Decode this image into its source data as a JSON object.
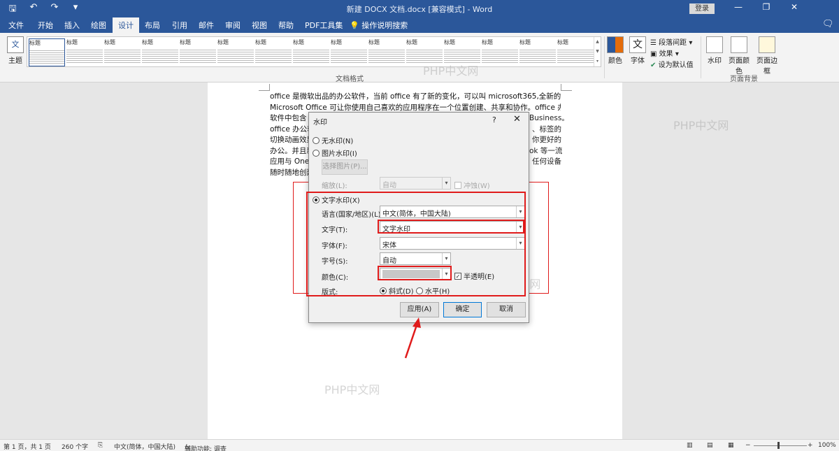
{
  "titlebar": {
    "title": "新建 DOCX 文档.docx [兼容模式] - Word",
    "login": "登录",
    "qat": [
      "save-icon",
      "undo-icon",
      "redo-icon",
      "customize-icon"
    ],
    "qat_glyphs": [
      "🖫",
      "↶",
      "↷",
      "▾"
    ],
    "controls": [
      "—",
      "❐",
      "✕"
    ]
  },
  "tabs": [
    {
      "label": "文件"
    },
    {
      "label": "开始"
    },
    {
      "label": "插入"
    },
    {
      "label": "绘图"
    },
    {
      "label": "设计"
    },
    {
      "label": "布局"
    },
    {
      "label": "引用"
    },
    {
      "label": "邮件"
    },
    {
      "label": "审阅"
    },
    {
      "label": "视图"
    },
    {
      "label": "帮助"
    },
    {
      "label": "PDF工具集"
    }
  ],
  "tell_me": "操作说明搜索",
  "ribbon": {
    "theme": "主题",
    "theme_icon_text": "文",
    "styles_group": "文档格式",
    "style_thumbs": [
      "标题",
      "标题",
      "标题",
      "标题",
      "标题",
      "标题",
      "标题",
      "标题",
      "标题",
      "标题",
      "标题",
      "标题",
      "标题",
      "标题",
      "标题",
      "标题"
    ],
    "colors": "颜色",
    "fonts": "字体",
    "fonts_icon_text": "文",
    "para_spacing": "段落间距",
    "effects": "效果",
    "set_default": "设为默认值",
    "watermark": "水印",
    "page_color": "页面颜色",
    "page_border": "页面边框",
    "page_bg_group": "页面背景"
  },
  "document": {
    "lines": [
      "office 是微软出品的办公软件，当前 office 有了新的变化，可以叫 microsoft365,全新的",
      "Microsoft Office 可让你使用自己喜欢的应用程序在一个位置创建、共享和协作。office 办公",
      "软件中包含",
      "office 办公软",
      "切换动画效果",
      "办公。并且新",
      "应用与 OneD",
      "随时随地创建"
    ],
    "right_fragments": [
      "Business。",
      "、标签的",
      "你更好的",
      "ok 等一流",
      "任何设备"
    ]
  },
  "dialog": {
    "title": "水印",
    "help": "?",
    "close": "✕",
    "no_watermark": "无水印(N)",
    "picture_watermark": "图片水印(I)",
    "select_picture": "选择图片(P)...",
    "scale_label": "缩放(L):",
    "scale_value": "自动",
    "washout": "冲蚀(W)",
    "text_watermark": "文字水印(X)",
    "language_label": "语言(国家/地区)(L):",
    "language_value": "中文(简体，中国大陆)",
    "text_label": "文字(T):",
    "text_value": "文字水印",
    "font_label": "字体(F):",
    "font_value": "宋体",
    "size_label": "字号(S):",
    "size_value": "自动",
    "color_label": "颜色(C):",
    "color_value": "#c8c8c8",
    "semitransparent": "半透明(E)",
    "semitransparent_checked": true,
    "layout_label": "版式:",
    "diagonal": "斜式(D)",
    "horizontal": "水平(H)",
    "apply": "应用(A)",
    "ok": "确定",
    "cancel": "取消"
  },
  "statusbar": {
    "page": "第 1 页，共 1 页",
    "words": "260 个字",
    "language": "中文(简体，中国大陆)",
    "accessibility": "辅助功能: 调查",
    "zoom": "100%"
  },
  "watermarks": [
    "PHP中文网",
    "PHP中文网",
    "PHP中文网",
    "PHP中文网"
  ],
  "colors": {
    "brand": "#2b579a",
    "annotation": "#e01b1b"
  }
}
